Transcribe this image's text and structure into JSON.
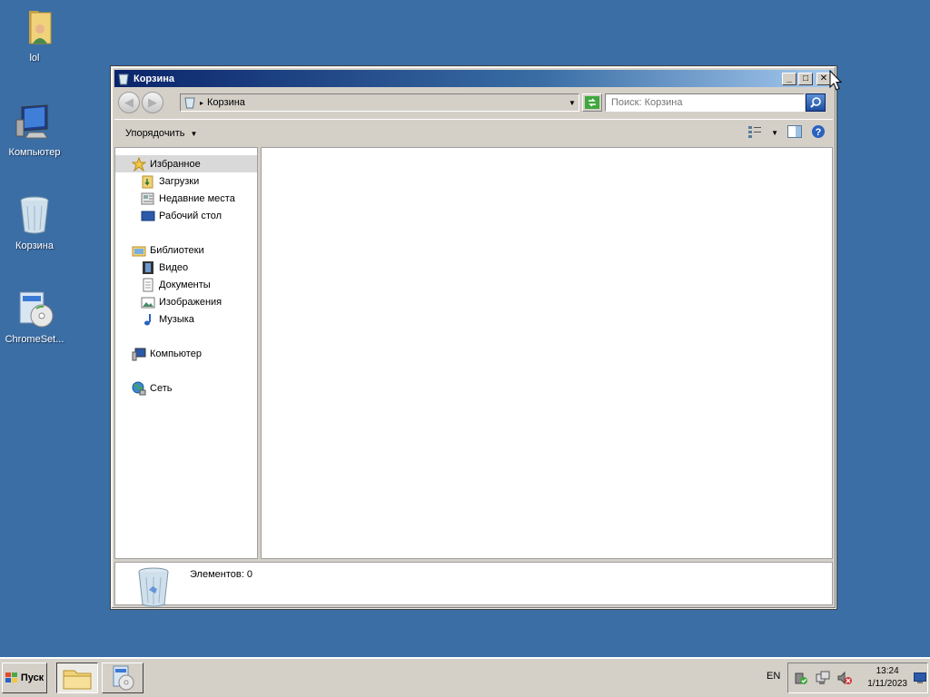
{
  "desktop": {
    "icons": [
      {
        "label": "lol",
        "icon": "user-folder-icon"
      },
      {
        "label": "Компьютер",
        "icon": "computer-icon"
      },
      {
        "label": "Корзина",
        "icon": "recycle-bin-icon"
      },
      {
        "label": "ChromeSet...",
        "icon": "installer-icon"
      }
    ]
  },
  "window": {
    "title": "Корзина",
    "controls": {
      "minimize": "_",
      "maximize": "□",
      "close": "✕"
    },
    "address": {
      "path": "Корзина",
      "separator": "▸",
      "dropdown": "▼"
    },
    "search": {
      "placeholder": "Поиск: Корзина"
    },
    "toolbar": {
      "organize": "Упорядочить",
      "caret": "▼"
    },
    "nav": {
      "favorites": {
        "label": "Избранное",
        "items": [
          "Загрузки",
          "Недавние места",
          "Рабочий стол"
        ]
      },
      "libraries": {
        "label": "Библиотеки",
        "items": [
          "Видео",
          "Документы",
          "Изображения",
          "Музыка"
        ]
      },
      "computer": {
        "label": "Компьютер"
      },
      "network": {
        "label": "Сеть"
      }
    },
    "details": {
      "count_text": "Элементов: 0"
    }
  },
  "taskbar": {
    "start_label": "Пуск",
    "language": "EN",
    "clock": {
      "time": "13:24",
      "date": "1/11/2023"
    }
  },
  "colors": {
    "desktop": "#3a6ea5",
    "title_active_start": "#0a246a",
    "title_active_end": "#a6caf0",
    "chrome": "#d4d0c8"
  }
}
